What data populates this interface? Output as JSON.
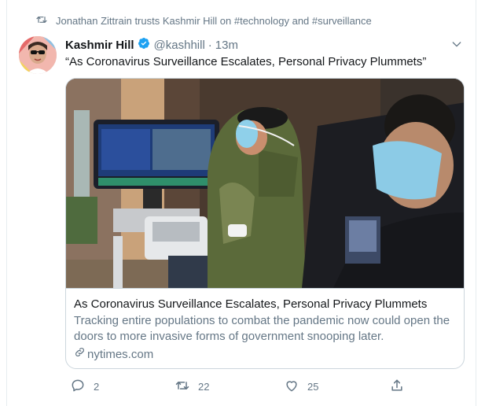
{
  "retweet_context": {
    "text": "Jonathan Zittrain trusts Kashmir Hill on #technology and #surveillance",
    "icon": "retweet-icon"
  },
  "author": {
    "name": "Kashmir Hill",
    "handle": "@kashhill",
    "separator": "·",
    "time": "13m",
    "verified": true
  },
  "tweet": {
    "text": "“As Coronavirus Surveillance Escalates, Personal Privacy Plummets”"
  },
  "card": {
    "title": "As Coronavirus Surveillance Escalates, Personal Privacy Plummets",
    "description": "Tracking entire populations to combat the pandemic now could open the doors to more invasive forms of government snooping later.",
    "domain": "nytimes.com"
  },
  "actions": {
    "replies": "2",
    "retweets": "22",
    "likes": "25"
  },
  "colors": {
    "accent": "#1da1f2",
    "muted": "#657786",
    "border": "#ccd6dd"
  }
}
